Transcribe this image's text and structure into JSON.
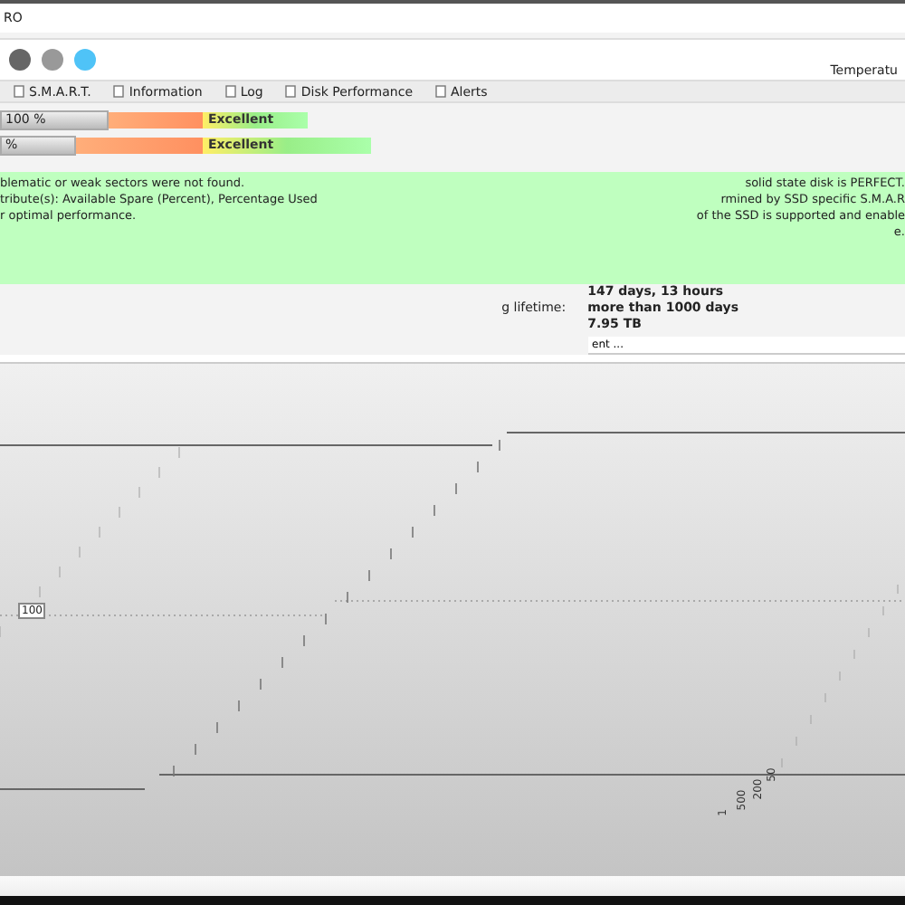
{
  "window": {
    "title": "RO"
  },
  "toolbar_right": {
    "label": "Temperatu"
  },
  "tabs": [
    {
      "label": "S.M.A.R.T.",
      "selected": false
    },
    {
      "label": "Information",
      "selected": false
    },
    {
      "label": "Log",
      "selected": false
    },
    {
      "label": "Disk Performance",
      "selected": false
    },
    {
      "label": "Alerts",
      "selected": false
    }
  ],
  "health_bars": [
    {
      "reading": "100 %",
      "level": 1,
      "rating": "Excellent"
    },
    {
      "reading": "%",
      "level": 1,
      "rating": "Excellent"
    }
  ],
  "status_panel": {
    "left_lines": [
      "blematic or weak sectors were not found.",
      "tribute(s):  Available Spare (Percent), Percentage Used",
      "r optimal performance."
    ],
    "right_lines": [
      "solid state disk is PERFECT.",
      "rmined by SSD specific S.M.A.R",
      "of the SSD is supported and enable",
      "e."
    ]
  },
  "stats": [
    {
      "value": "147 days, 13 hours"
    },
    {
      "label": "g lifetime:",
      "value": "more than 1000 days"
    },
    {
      "value": "7.95 TB"
    }
  ],
  "comment_field": {
    "value": "ent ..."
  },
  "chart": {
    "marker_label": "100",
    "axis_labels": [
      "50",
      "200",
      "500",
      "1"
    ]
  }
}
